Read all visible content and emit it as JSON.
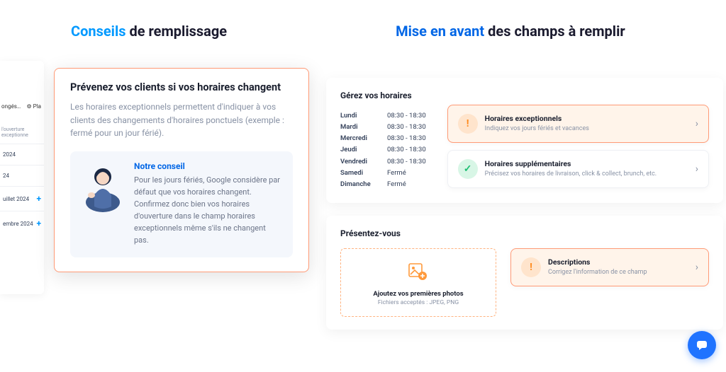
{
  "header": {
    "left_prefix": "Conseils",
    "left_rest": " de remplissage",
    "right_prefix": "Mise en avant",
    "right_rest": " des champs à remplir"
  },
  "bg_panel": {
    "hdr_left": "ongés…",
    "hdr_right": "⚙ Pla",
    "sub_label": "l'ouverture exceptionne",
    "rows": [
      "2024",
      "24",
      "uillet 2024",
      "embre 2024"
    ]
  },
  "callout": {
    "title": "Prévenez vos clients si vos horaires changent",
    "desc": "Les horaires exceptionnels permettent d'indiquer à vos clients des changements d'horaires ponctuels (exemple : fermé pour un jour férié).",
    "tip_title": "Notre conseil",
    "tip_text": "Pour les jours fériés, Google considère par défaut que vos horaires changent. Confirmez donc bien vos horaires d'ouverture dans le champ horaires exceptionnels même s'ils ne changent pas."
  },
  "hours_panel": {
    "title": "Gérez vos horaires",
    "days": [
      {
        "day": "Lundi",
        "time": "08:30 - 18:30"
      },
      {
        "day": "Mardi",
        "time": "08:30 - 18:30"
      },
      {
        "day": "Mercredi",
        "time": "08:30 - 18:30"
      },
      {
        "day": "Jeudi",
        "time": "08:30 - 18:30"
      },
      {
        "day": "Vendredi",
        "time": "08:30 - 18:30"
      },
      {
        "day": "Samedi",
        "time": "Fermé"
      },
      {
        "day": "Dimanche",
        "time": "Fermé"
      }
    ],
    "card1_title": "Horaires exceptionnels",
    "card1_sub": "Indiquez vos jours fériés et vacances",
    "card2_title": "Horaires supplémentaires",
    "card2_sub": "Précisez vos horaires de livraison, click & collect, brunch, etc."
  },
  "present_panel": {
    "title": "Présentez-vous",
    "upload_title": "Ajoutez vos premières photos",
    "upload_sub": "Fichiers acceptés : JPEG, PNG",
    "card_title": "Descriptions",
    "card_sub": "Corrigez l'information de ce champ"
  }
}
